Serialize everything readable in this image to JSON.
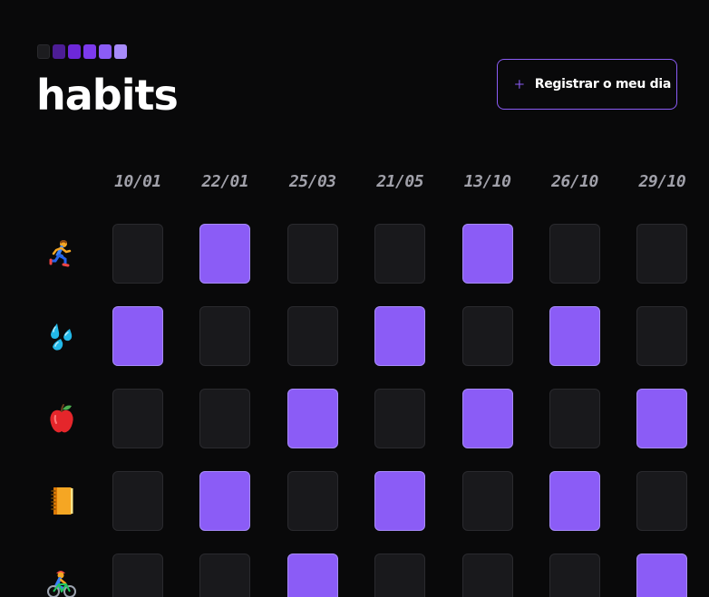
{
  "header": {
    "title": "habits",
    "logo_square_colors": [
      "#1c1c1f",
      "#4c1d95",
      "#6d28d9",
      "#7c3aed",
      "#8b5cf6",
      "#a78bfa"
    ],
    "new_habit_button": {
      "label": "Registrar o meu dia",
      "icon": "plus-icon"
    }
  },
  "colors": {
    "background": "#09090a",
    "accent": "#8b5cf6",
    "cell_empty": "#19191c",
    "date_text": "#a1a1aa"
  },
  "summary": {
    "dates": [
      "10/01",
      "22/01",
      "25/03",
      "21/05",
      "13/10",
      "26/10",
      "29/10"
    ],
    "habits": [
      {
        "icon": "runner-icon",
        "completed": [
          false,
          true,
          false,
          false,
          true,
          false,
          false
        ]
      },
      {
        "icon": "water-drops-icon",
        "completed": [
          true,
          false,
          false,
          true,
          false,
          true,
          false
        ]
      },
      {
        "icon": "apple-icon",
        "completed": [
          false,
          false,
          true,
          false,
          true,
          false,
          true
        ]
      },
      {
        "icon": "notebook-icon",
        "completed": [
          false,
          true,
          false,
          true,
          false,
          true,
          false
        ]
      },
      {
        "icon": "cyclist-icon",
        "completed": [
          false,
          false,
          true,
          false,
          false,
          false,
          true
        ]
      }
    ]
  }
}
